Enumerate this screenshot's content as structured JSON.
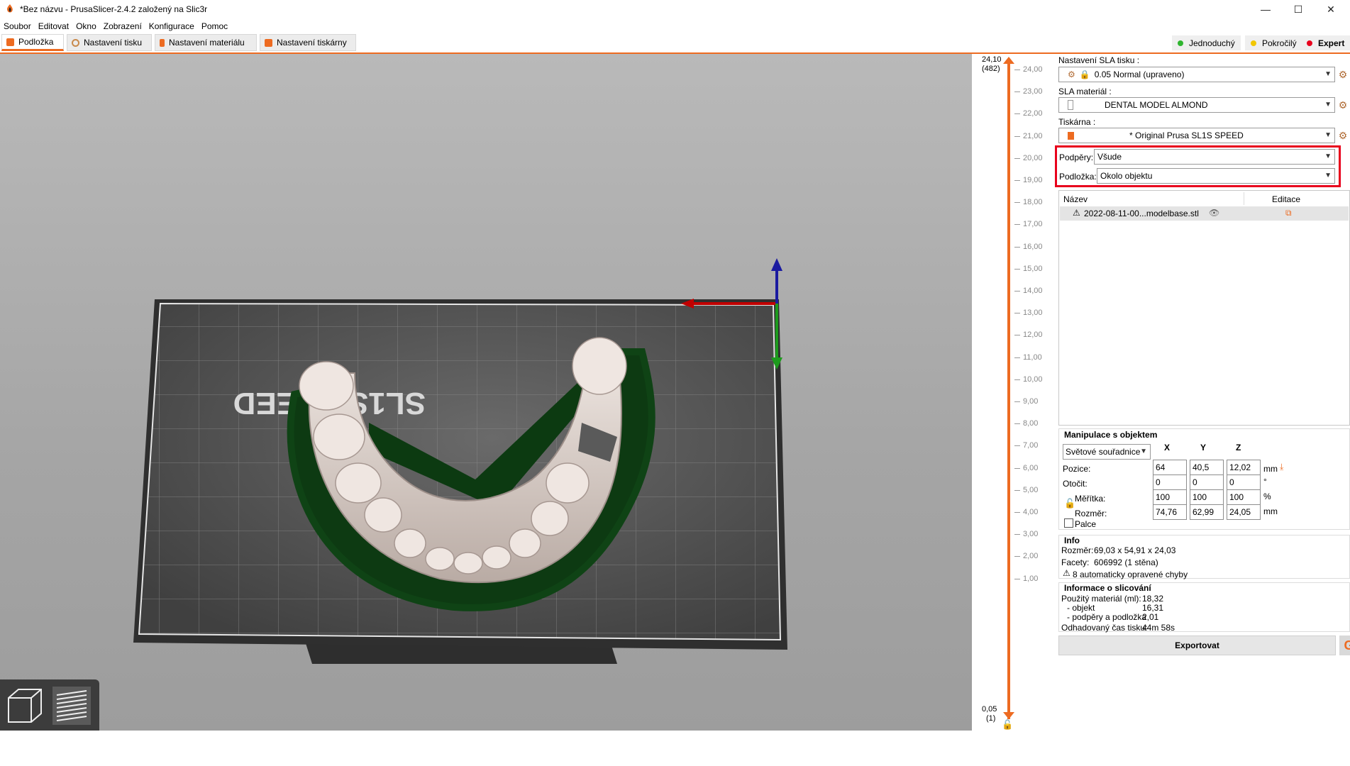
{
  "window": {
    "title": "*Bez názvu - PrusaSlicer-2.4.2 založený na Slic3r",
    "minimize": "—",
    "maximize": "☐",
    "close": "✕"
  },
  "menu": [
    {
      "label": "Soubor"
    },
    {
      "label": "Editovat"
    },
    {
      "label": "Okno"
    },
    {
      "label": "Zobrazení"
    },
    {
      "label": "Konfigurace"
    },
    {
      "label": "Pomoc"
    }
  ],
  "tabs": [
    {
      "label": "Podložka",
      "active": true,
      "color": "#ed6b21"
    },
    {
      "label": "Nastavení tisku",
      "color": "#c98a4c"
    },
    {
      "label": "Nastavení materiálu",
      "color": "#ed6b21"
    },
    {
      "label": "Nastavení tiskárny",
      "color": "#ed6b21"
    }
  ],
  "modes": [
    {
      "label": "Jednoduchý",
      "color": "#2fb52f"
    },
    {
      "label": "Pokročilý",
      "color": "#f2c700"
    },
    {
      "label": "Expert",
      "color": "#e8001c"
    }
  ],
  "slider": {
    "top_value": "24,10",
    "top_layer": "(482)",
    "bottom_value": "0,05",
    "bottom_layer": "(1)",
    "ticks": [
      "24,00",
      "23,00",
      "22,00",
      "21,00",
      "20,00",
      "19,00",
      "18,00",
      "17,00",
      "16,00",
      "15,00",
      "14,00",
      "13,00",
      "12,00",
      "11,00",
      "10,00",
      "9,00",
      "8,00",
      "7,00",
      "6,00",
      "5,00",
      "4,00",
      "3,00",
      "2,00",
      "1,00"
    ]
  },
  "sidebar": {
    "sla_print_label": "Nastavení SLA tisku :",
    "sla_print_value": "0.05 Normal (upraveno)",
    "sla_material_label": "SLA materiál :",
    "sla_material_value": "DENTAL MODEL ALMOND",
    "printer_label": "Tiskárna :",
    "printer_value": "* Original Prusa SL1S SPEED",
    "supports_label": "Podpěry:",
    "supports_value": "Všude",
    "pad_label": "Podložka:",
    "pad_value": "Okolo objektu",
    "highlight_color": "#e8001c"
  },
  "object_list": {
    "col_name": "Název",
    "col_edit": "Editace",
    "items": [
      {
        "name": "2022-08-11-00...modelbase.stl"
      }
    ]
  },
  "manipulation": {
    "title": "Manipulace s objektem",
    "coord_system": "Světové souřadnice",
    "axes": [
      "X",
      "Y",
      "Z"
    ],
    "rows": [
      {
        "label": "Pozice:",
        "values": [
          "64",
          "40,5",
          "12,02"
        ],
        "unit": "mm"
      },
      {
        "label": "Otočit:",
        "values": [
          "0",
          "0",
          "0"
        ],
        "unit": "°"
      },
      {
        "label": "Měřítka:",
        "values": [
          "100",
          "100",
          "100"
        ],
        "unit": "%"
      },
      {
        "label": "Rozměr:",
        "values": [
          "74,76",
          "62,99",
          "24,05"
        ],
        "unit": "mm"
      }
    ],
    "inches_label": "Palce"
  },
  "info": {
    "title": "Info",
    "size_label": "Rozměr:",
    "size_value": "69,03 x 54,91 x 24,03",
    "facets_label": "Facety:",
    "facets_value": "606992 (1 stěna)",
    "errors_text": "8 automaticky opravené chyby"
  },
  "slice_info": {
    "title": "Informace o slicování",
    "rows": [
      {
        "label": "Použitý materiál (ml):",
        "value": "18,32"
      },
      {
        "label": "- objekt",
        "value": "16,31"
      },
      {
        "label": "- podpěry a podložka",
        "value": "2,01"
      },
      {
        "label": "Odhadovaný čas tisku:",
        "value": "44m 58s"
      }
    ]
  },
  "export": {
    "label": "Exportovat"
  },
  "bed_text": "SL1S SPEED"
}
